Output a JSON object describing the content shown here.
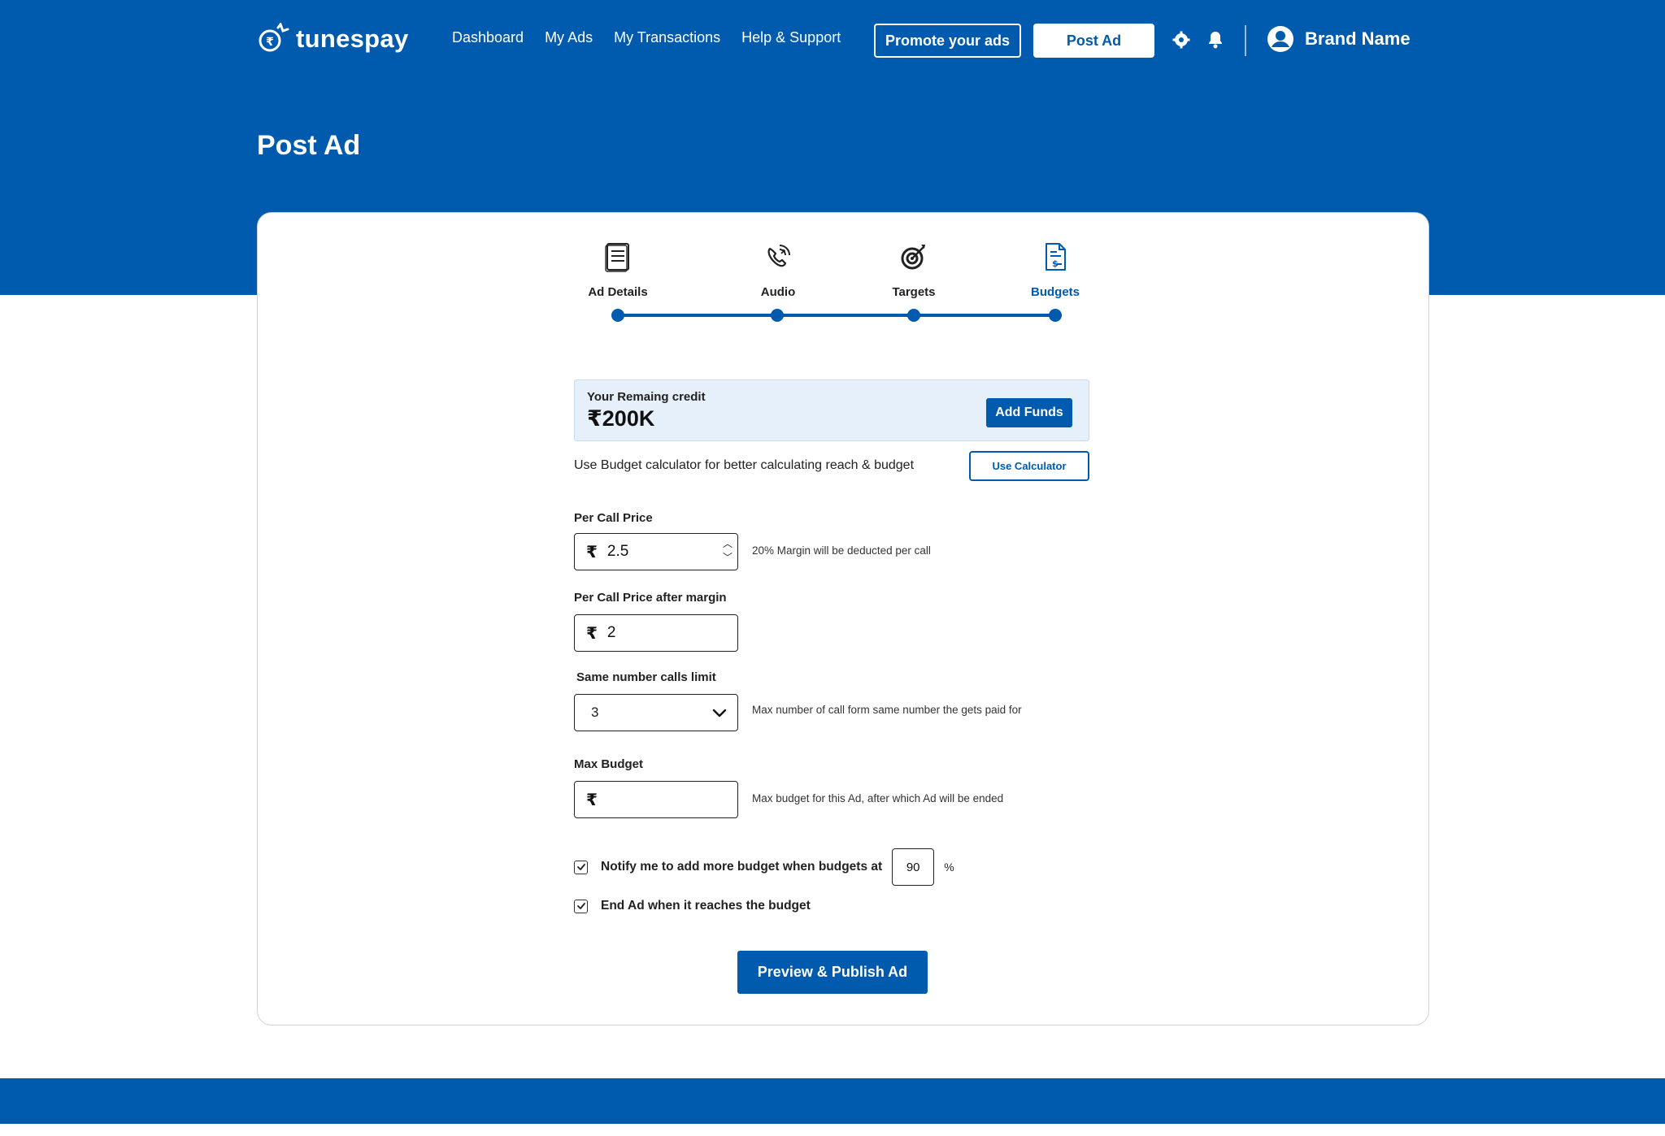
{
  "app": {
    "logo_text": "tunespay"
  },
  "nav": {
    "items": [
      "Dashboard",
      "My Ads",
      "My Transactions",
      "Help & Support"
    ],
    "promote_label": "Promote your ads",
    "post_ad_label": "Post Ad"
  },
  "icons": {
    "settings": "gear-icon",
    "notifications": "bell-icon",
    "user": "user-circle-icon"
  },
  "user": {
    "name": "Brand Name"
  },
  "page": {
    "title": "Post Ad"
  },
  "stepper": {
    "steps": [
      {
        "label": "Ad Details",
        "icon": "document-list-icon",
        "active": false
      },
      {
        "label": "Audio",
        "icon": "phone-call-icon",
        "active": false
      },
      {
        "label": "Targets",
        "icon": "target-arrow-icon",
        "active": false
      },
      {
        "label": "Budgets",
        "icon": "invoice-icon",
        "active": true
      }
    ]
  },
  "credit": {
    "label": "Your Remaing credit",
    "value": "₹200K",
    "add_funds_label": "Add Funds"
  },
  "calculator": {
    "text": "Use Budget calculator for better calculating reach & budget",
    "button_label": "Use Calculator"
  },
  "form": {
    "currency_symbol": "₹",
    "per_call_price": {
      "label": "Per Call Price",
      "value": "2.5",
      "hint": "20% Margin will be deducted per call"
    },
    "per_call_after_margin": {
      "label": "Per Call Price after margin",
      "value": "2"
    },
    "same_number_limit": {
      "label": "Same number calls limit",
      "value": "3",
      "hint": "Max number of call form same number the gets paid for"
    },
    "max_budget": {
      "label": "Max Budget",
      "value": "",
      "hint": "Max budget for this Ad, after which Ad will be ended"
    },
    "notify": {
      "label": "Notify me to add more budget when budgets at",
      "value": "90",
      "unit": "%",
      "checked": true
    },
    "end_ad": {
      "label": "End Ad when it reaches the budget",
      "checked": true
    }
  },
  "actions": {
    "publish_label": "Preview & Publish Ad"
  },
  "colors": {
    "brand": "#005BAE",
    "credit_bg": "#E6F0FA"
  }
}
